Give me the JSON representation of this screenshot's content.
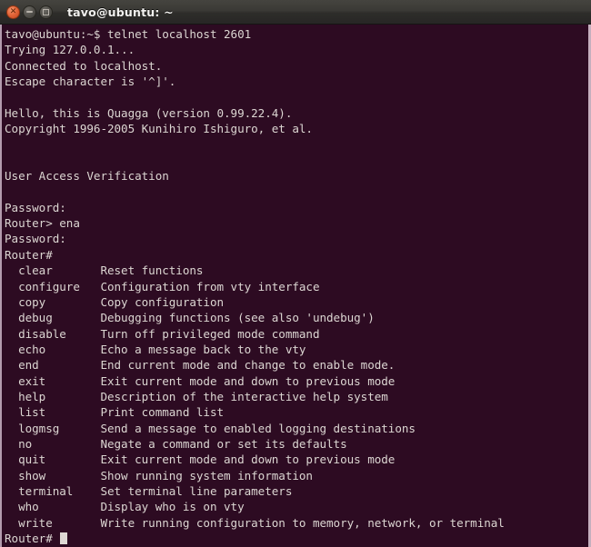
{
  "window": {
    "title": "tavo@ubuntu: ~",
    "controls": [
      {
        "name": "close",
        "label": "×"
      },
      {
        "name": "minimize",
        "label": "−"
      },
      {
        "name": "maximize",
        "label": "□"
      }
    ],
    "colors": {
      "titlebar_top": "#45443f",
      "titlebar_bottom": "#272625",
      "close_button": "#e4663a",
      "terminal_background": "#2d0b22",
      "terminal_foreground": "#dcd6d2",
      "border": "#c5afbe"
    }
  },
  "terminal": {
    "prompt_user": "tavo@ubuntu:~$",
    "command_entered": "telnet localhost 2601",
    "cursor": "block",
    "lines": [
      "tavo@ubuntu:~$ telnet localhost 2601",
      "Trying 127.0.0.1...",
      "Connected to localhost.",
      "Escape character is '^]'.",
      "",
      "Hello, this is Quagga (version 0.99.22.4).",
      "Copyright 1996-2005 Kunihiro Ishiguro, et al.",
      "",
      "",
      "User Access Verification",
      "",
      "Password:",
      "Router> ena",
      "Password:",
      "Router#",
      "  clear       Reset functions",
      "  configure   Configuration from vty interface",
      "  copy        Copy configuration",
      "  debug       Debugging functions (see also 'undebug')",
      "  disable     Turn off privileged mode command",
      "  echo        Echo a message back to the vty",
      "  end         End current mode and change to enable mode.",
      "  exit        Exit current mode and down to previous mode",
      "  help        Description of the interactive help system",
      "  list        Print command list",
      "  logmsg      Send a message to enabled logging destinations",
      "  no          Negate a command or set its defaults",
      "  quit        Exit current mode and down to previous mode",
      "  show        Show running system information",
      "  terminal    Set terminal line parameters",
      "  who         Display who is on vty",
      "  write       Write running configuration to memory, network, or terminal"
    ],
    "final_prompt": "Router#",
    "session": {
      "host": "localhost",
      "port": "2601",
      "software": "Quagga",
      "version": "0.99.22.4",
      "copyright": "Copyright 1996-2005 Kunihiro Ishiguro, et al.",
      "banner": "User Access Verification"
    },
    "commands": [
      {
        "name": "clear",
        "description": "Reset functions"
      },
      {
        "name": "configure",
        "description": "Configuration from vty interface"
      },
      {
        "name": "copy",
        "description": "Copy configuration"
      },
      {
        "name": "debug",
        "description": "Debugging functions (see also 'undebug')"
      },
      {
        "name": "disable",
        "description": "Turn off privileged mode command"
      },
      {
        "name": "echo",
        "description": "Echo a message back to the vty"
      },
      {
        "name": "end",
        "description": "End current mode and change to enable mode."
      },
      {
        "name": "exit",
        "description": "Exit current mode and down to previous mode"
      },
      {
        "name": "help",
        "description": "Description of the interactive help system"
      },
      {
        "name": "list",
        "description": "Print command list"
      },
      {
        "name": "logmsg",
        "description": "Send a message to enabled logging destinations"
      },
      {
        "name": "no",
        "description": "Negate a command or set its defaults"
      },
      {
        "name": "quit",
        "description": "Exit current mode and down to previous mode"
      },
      {
        "name": "show",
        "description": "Show running system information"
      },
      {
        "name": "terminal",
        "description": "Set terminal line parameters"
      },
      {
        "name": "who",
        "description": "Display who is on vty"
      },
      {
        "name": "write",
        "description": "Write running configuration to memory, network, or terminal"
      }
    ]
  }
}
